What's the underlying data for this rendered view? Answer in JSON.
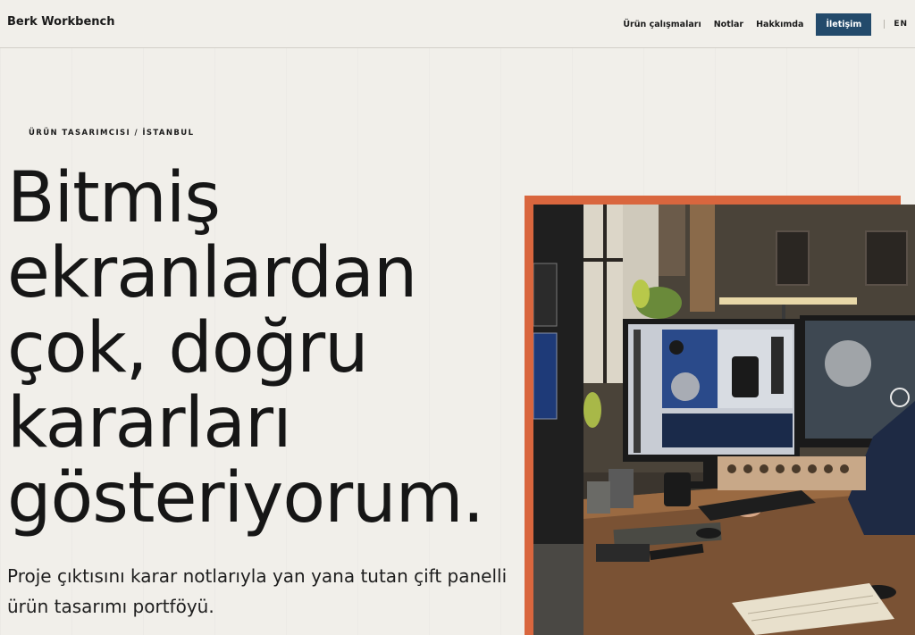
{
  "header": {
    "brand": "Berk Workbench",
    "nav": {
      "work": "Ürün çalışmaları",
      "notes": "Notlar",
      "about": "Hakkımda",
      "contact": "İletişim",
      "lang": "EN"
    }
  },
  "hero": {
    "kicker": "ÜRÜN TASARIMCISI / İSTANBUL",
    "headline": "Bitmiş ekranlardan çok, doğru kararları gösteriyorum.",
    "lede": "Proje çıktısını karar notlarıyla yan yana tutan çift panelli ürün tasarımı portföyü."
  },
  "colors": {
    "background": "#f1efea",
    "accent_button": "#234a6b",
    "image_frame": "#d9663e"
  }
}
